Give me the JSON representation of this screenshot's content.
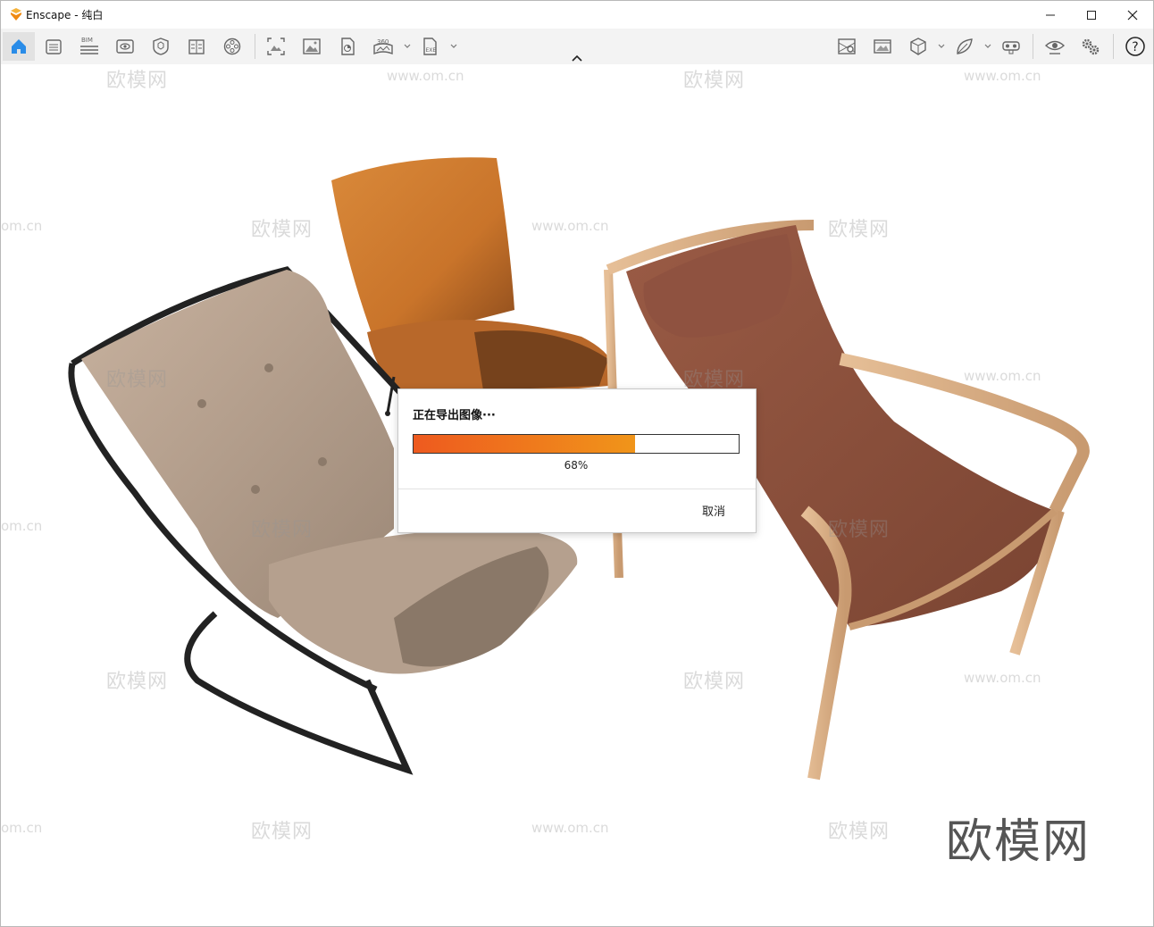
{
  "window": {
    "title": "Enscape - 纯白"
  },
  "toolbar": {
    "left_icons": [
      "home-icon",
      "views-icon",
      "bim-icon",
      "visual-settings-icon",
      "cube-shield-icon",
      "book-icon",
      "render-settings-icon",
      "screenshot-icon",
      "image-icon",
      "batch-render-icon",
      "panorama-360-icon",
      "export-exe-icon"
    ],
    "right_icons": [
      "map-icon",
      "image-stack-icon",
      "cube-icon",
      "asset-leaf-icon",
      "vr-headset-icon",
      "eye-icon",
      "settings-gears-icon",
      "help-icon"
    ],
    "bim_label": "BIM",
    "pano_label": "360",
    "exe_label": "EXE",
    "help_label": "?"
  },
  "watermarks": {
    "brand": "欧模网",
    "url": "www.om.cn",
    "url_short": "om.cn"
  },
  "dialog": {
    "title": "正在导出图像···",
    "progress": 0.68,
    "percent_text": "68%",
    "cancel_label": "取消"
  },
  "colors": {
    "progress_start": "#ee5a1f",
    "progress_end": "#f0951a",
    "home_active": "#2a8ce8",
    "logo_orange": "#f29a1c"
  }
}
